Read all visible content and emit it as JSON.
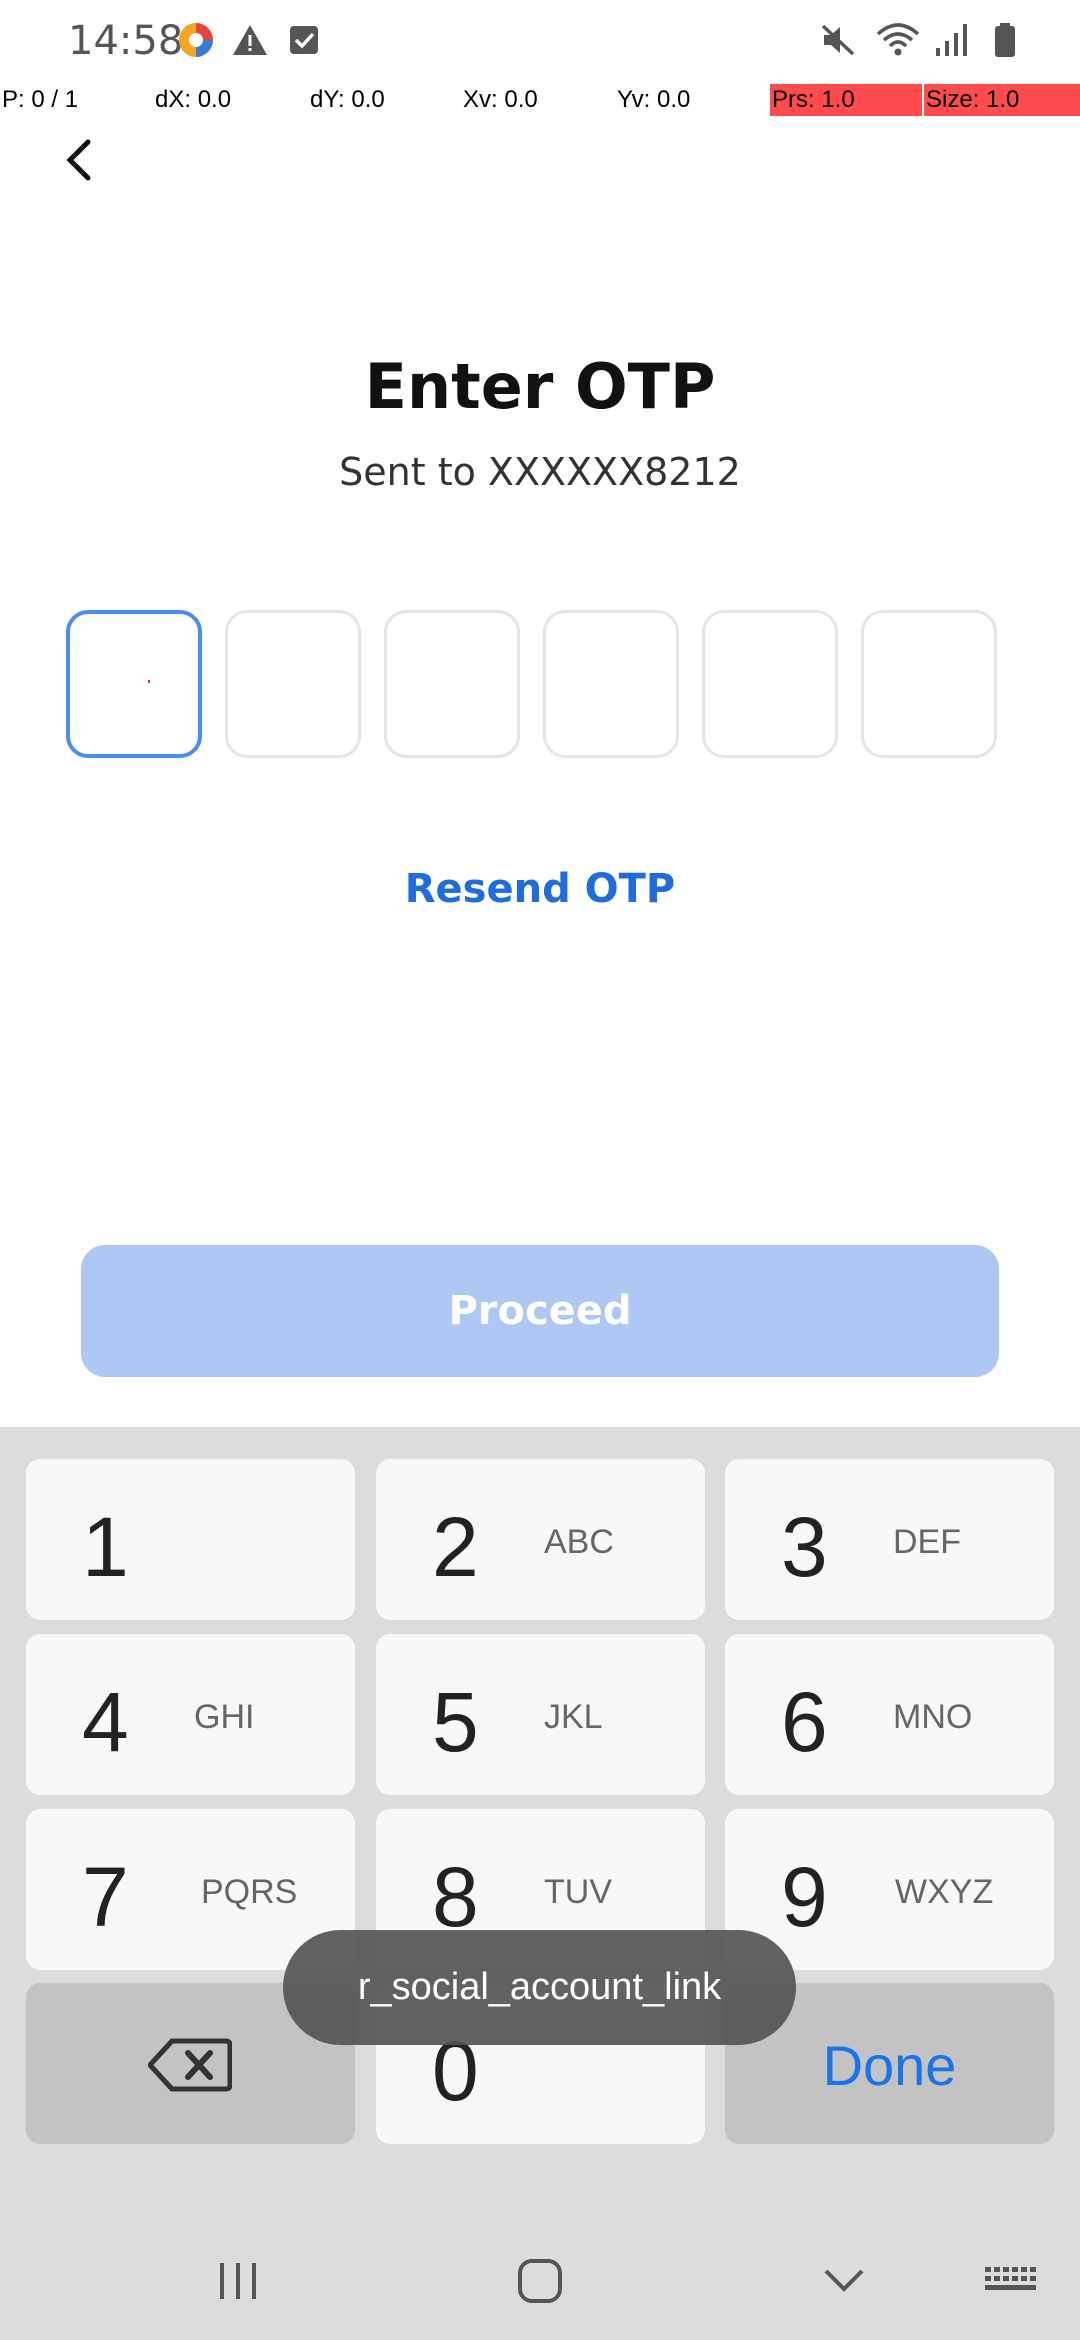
{
  "status_bar": {
    "time": "14:58",
    "left_icons": [
      "assistant-app-icon",
      "warning-icon",
      "checkbox-icon"
    ],
    "right_icons": [
      "mute-icon",
      "wifi-icon",
      "signal-icon",
      "battery-icon"
    ]
  },
  "pointer_overlay": {
    "p": "P: 0 / 1",
    "dx": "dX: 0.0",
    "dy": "dY: 0.0",
    "xv": "Xv: 0.0",
    "yv": "Yv: 0.0",
    "prs": "Prs: 1.0",
    "size": "Size: 1.0",
    "highlight_color": "#ff4b4b"
  },
  "header": {
    "title": "Enter OTP",
    "subtitle": "Sent to XXXXXX8212"
  },
  "otp": {
    "digits": [
      "",
      "",
      "",
      "",
      "",
      ""
    ],
    "active_index": 0,
    "active_color": "#4a8fef"
  },
  "resend_label": "Resend OTP",
  "proceed_label": "Proceed",
  "keyboard": {
    "keys": [
      {
        "num": "1",
        "letters": ""
      },
      {
        "num": "2",
        "letters": "ABC"
      },
      {
        "num": "3",
        "letters": "DEF"
      },
      {
        "num": "4",
        "letters": "GHI"
      },
      {
        "num": "5",
        "letters": "JKL"
      },
      {
        "num": "6",
        "letters": "MNO"
      },
      {
        "num": "7",
        "letters": "PQRS"
      },
      {
        "num": "8",
        "letters": "TUV"
      },
      {
        "num": "9",
        "letters": "WXYZ"
      }
    ],
    "zero": "0",
    "done_label": "Done",
    "accent": "#1a73e8"
  },
  "toast": "r_social_account_link",
  "navbar": {
    "icons": [
      "recent-apps-icon",
      "home-icon",
      "hide-keyboard-icon",
      "keyboard-switch-icon"
    ]
  }
}
